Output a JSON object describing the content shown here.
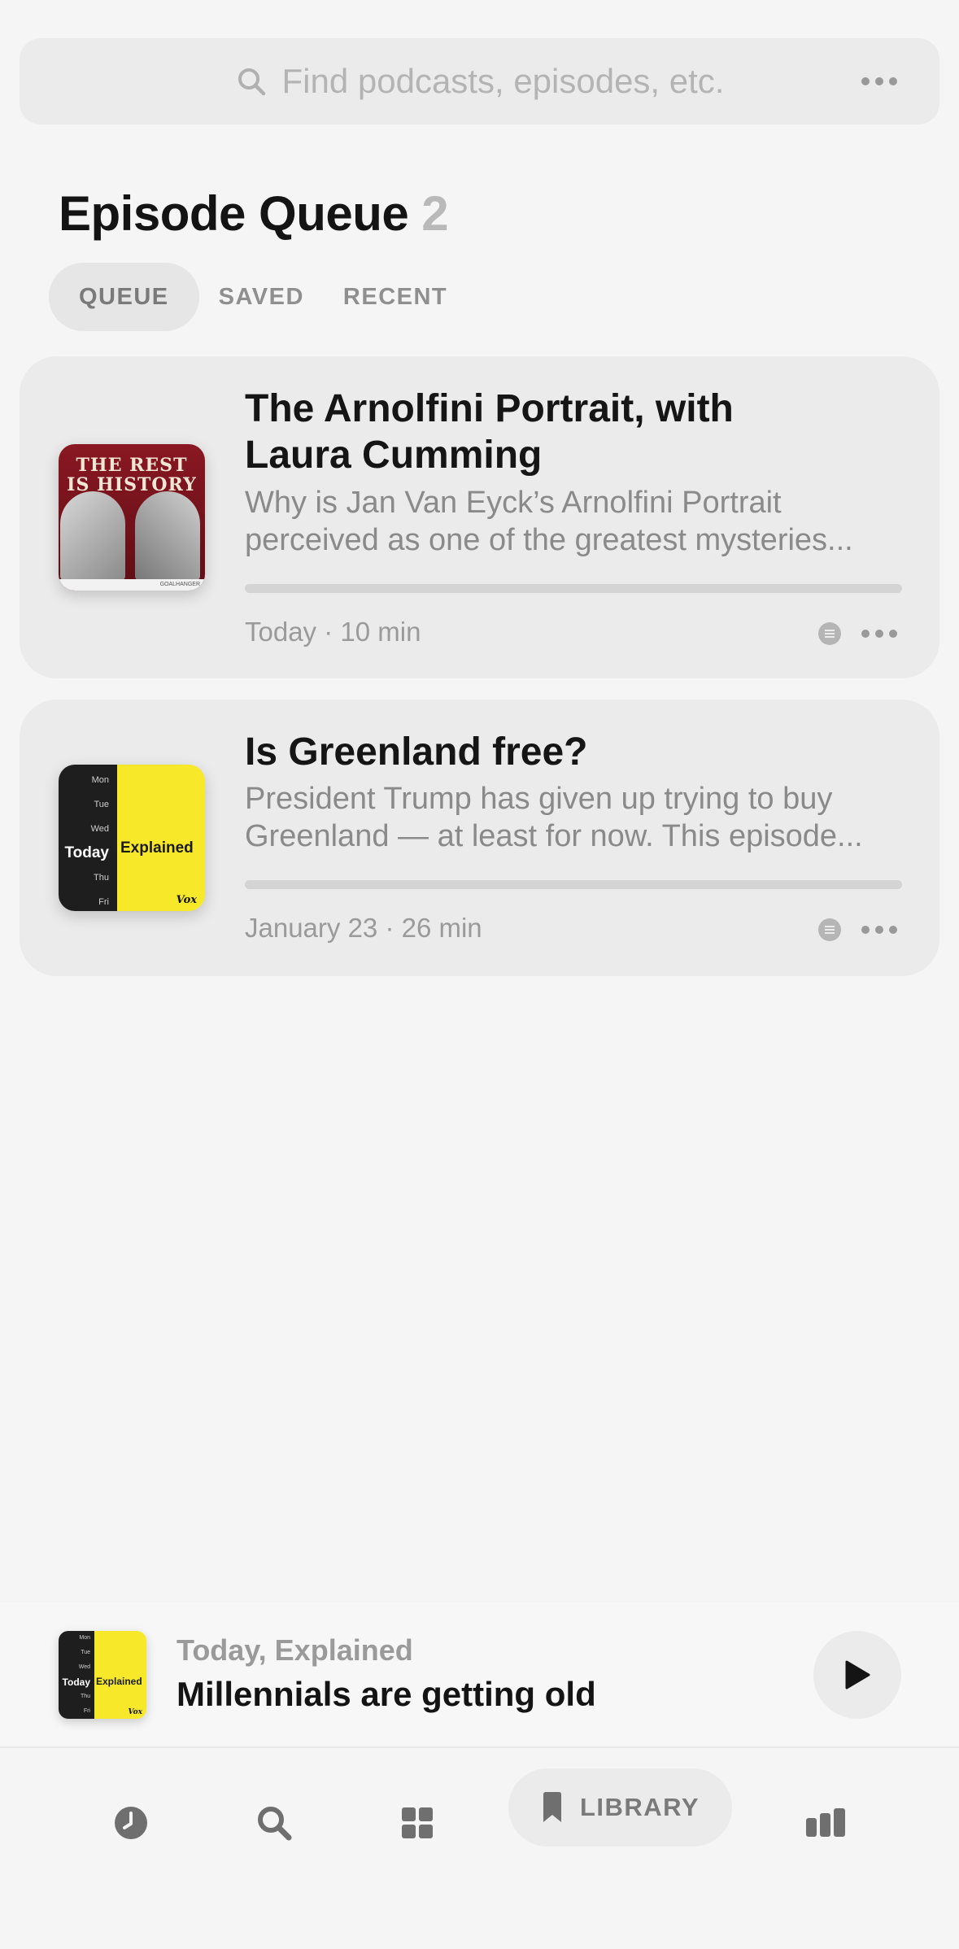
{
  "search": {
    "placeholder": "Find podcasts, episodes, etc."
  },
  "header": {
    "title": "Episode Queue",
    "count": "2"
  },
  "tabs": [
    {
      "label": "QUEUE",
      "active": true
    },
    {
      "label": "SAVED",
      "active": false
    },
    {
      "label": "RECENT",
      "active": false
    }
  ],
  "episodes": [
    {
      "title_line1": "The Arnolfini Portrait, with",
      "title_line2": "Laura Cumming",
      "desc_line1": "Why is Jan Van Eyck’s Arnolfini Portrait",
      "desc_line2": "perceived as one of the greatest mysteries...",
      "meta": "Today · 10 min",
      "progress": 0,
      "art": {
        "line1": "THE REST",
        "line2": "IS HISTORY",
        "footer": "GOALHANGER",
        "color": "#7a1520"
      }
    },
    {
      "title_line1": "Is Greenland free?",
      "desc_line1": "President Trump has given up trying to buy",
      "desc_line2": "Greenland — at least for now. This episode...",
      "meta": "January 23 · 26 min",
      "progress": 0,
      "art": {
        "days_top": [
          "Mon",
          "Tue",
          "Wed"
        ],
        "today": "Today",
        "explained": "Explained",
        "days_bottom": [
          "Thu",
          "Fri"
        ],
        "brand": "Vox",
        "color": "#f7e92a"
      }
    }
  ],
  "mini_player": {
    "show": "Today, Explained",
    "episode": "Millennials are getting old",
    "art": {
      "days_top": [
        "Mon",
        "Tue",
        "Wed"
      ],
      "today": "Today",
      "explained": "Explained",
      "days_bottom": [
        "Thu",
        "Fri"
      ],
      "brand": "Vox"
    }
  },
  "tabbar": {
    "items": [
      {
        "icon": "clock-icon"
      },
      {
        "icon": "search-icon"
      },
      {
        "icon": "grid-icon"
      },
      {
        "icon": "bookmark-icon",
        "label": "LIBRARY",
        "active": true
      },
      {
        "icon": "stats-icon"
      }
    ]
  }
}
